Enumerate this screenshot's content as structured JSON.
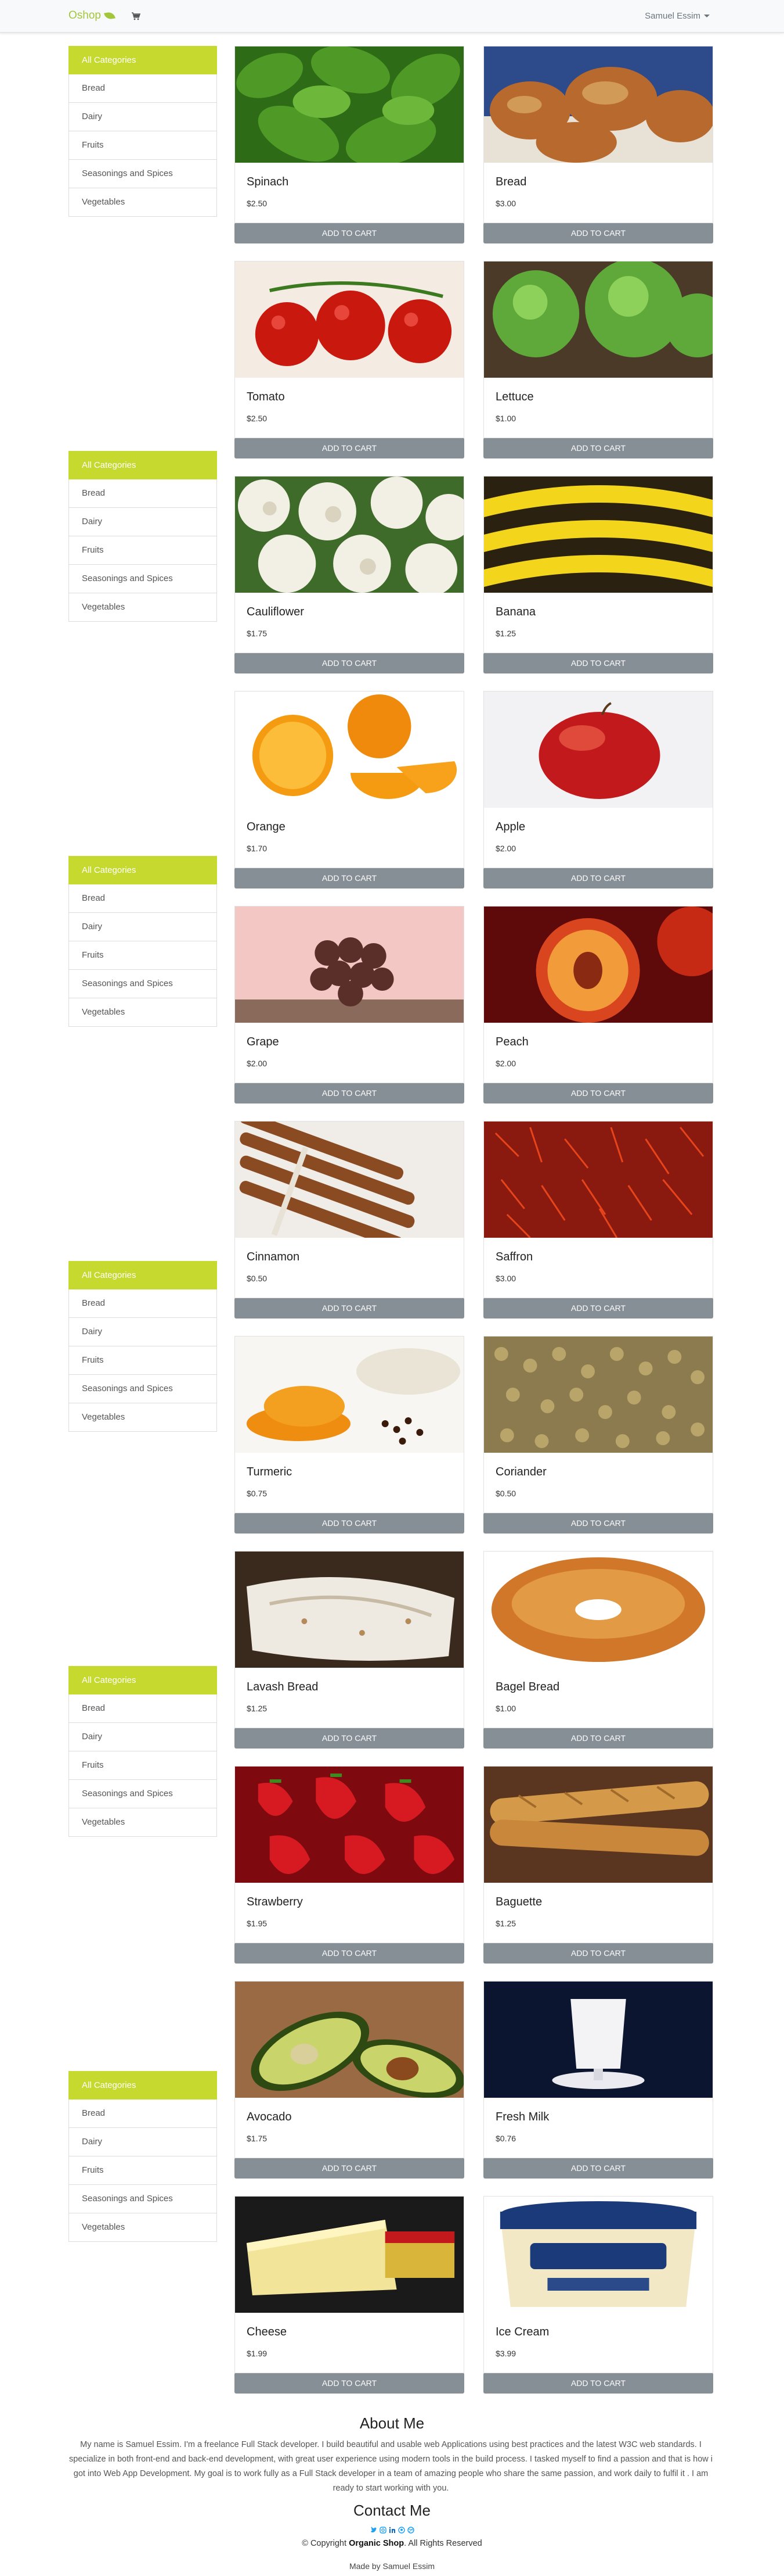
{
  "navbar": {
    "brand": "Oshop",
    "user_name": "Samuel Essim"
  },
  "sidebar": {
    "items": [
      "All Categories",
      "Bread",
      "Dairy",
      "Fruits",
      "Seasonings and Spices",
      "Vegetables"
    ]
  },
  "button_label": "Add to Cart",
  "products": [
    {
      "name": "Spinach",
      "price": "$2.50",
      "image": "spinach"
    },
    {
      "name": "Bread",
      "price": "$3.00",
      "image": "bread"
    },
    {
      "name": "Tomato",
      "price": "$2.50",
      "image": "tomato"
    },
    {
      "name": "Lettuce",
      "price": "$1.00",
      "image": "lettuce"
    },
    {
      "name": "Cauliflower",
      "price": "$1.75",
      "image": "cauliflower"
    },
    {
      "name": "Banana",
      "price": "$1.25",
      "image": "banana"
    },
    {
      "name": "Orange",
      "price": "$1.70",
      "image": "orange"
    },
    {
      "name": "Apple",
      "price": "$2.00",
      "image": "apple"
    },
    {
      "name": "Grape",
      "price": "$2.00",
      "image": "grape"
    },
    {
      "name": "Peach",
      "price": "$2.00",
      "image": "peach"
    },
    {
      "name": "Cinnamon",
      "price": "$0.50",
      "image": "cinnamon"
    },
    {
      "name": "Saffron",
      "price": "$3.00",
      "image": "saffron"
    },
    {
      "name": "Turmeric",
      "price": "$0.75",
      "image": "turmeric"
    },
    {
      "name": "Coriander",
      "price": "$0.50",
      "image": "coriander"
    },
    {
      "name": "Lavash Bread",
      "price": "$1.25",
      "image": "lavash"
    },
    {
      "name": "Bagel Bread",
      "price": "$1.00",
      "image": "bagel"
    },
    {
      "name": "Strawberry",
      "price": "$1.95",
      "image": "strawberry"
    },
    {
      "name": "Baguette",
      "price": "$1.25",
      "image": "baguette"
    },
    {
      "name": "Avocado",
      "price": "$1.75",
      "image": "avocado"
    },
    {
      "name": "Fresh Milk",
      "price": "$0.76",
      "image": "milk"
    },
    {
      "name": "Cheese",
      "price": "$1.99",
      "image": "cheese"
    },
    {
      "name": "Ice Cream",
      "price": "$3.99",
      "image": "icecream"
    }
  ],
  "footer": {
    "about_title": "About Me",
    "about_text": "My name is Samuel Essim. I'm a freelance Full Stack developer. I build beautiful and usable web Applications using best practices and the latest W3C web standards. I specialize in both front-end and back-end development, with great user experience using modern tools in the build process. I tasked myself to find a passion and that is how i got into Web App Development. My goal is to work fully as a Full Stack developer in a team of amazing people who share the same passion, and work daily to fulfil it . I am ready to start working with you.",
    "contact_title": "Contact Me",
    "social_icons": [
      "twitter-icon",
      "instagram-icon",
      "linkedin-icon",
      "github-icon",
      "dribbble-icon"
    ],
    "copyright_prefix": "© Copyright",
    "copyright_brand": "Organic Shop",
    "copyright_suffix": ". All Rights Reserved",
    "made_by": "Made by Samuel Essim"
  },
  "colors": {
    "accent": "#c5d92f",
    "brand": "#a4c63b",
    "button": "#868e96"
  }
}
